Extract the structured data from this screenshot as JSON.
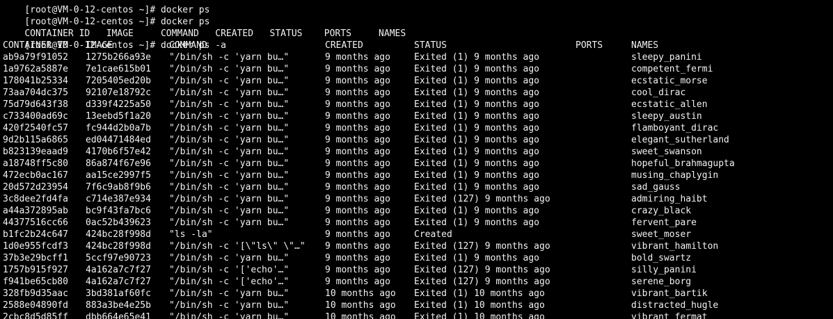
{
  "terminal": {
    "first_line_partial": "[root@VM-0-12-centos ~]# docker ps",
    "cmd1_prompt": "[root@VM-0-12-centos ~]# docker ps",
    "cmd1_header": "CONTAINER ID   IMAGE     COMMAND   CREATED   STATUS    PORTS     NAMES",
    "cmd2_prompt": "[root@VM-0-12-centos ~]# docker ps -a",
    "columns": [
      "CONTAINER ID",
      "IMAGE",
      "COMMAND",
      "CREATED",
      "STATUS",
      "PORTS",
      "NAMES"
    ],
    "rows": [
      {
        "id": "ab9a79f91052",
        "image": "1275b266a93e",
        "command": "\"/bin/sh -c 'yarn bu…\"",
        "created": "9 months ago",
        "status": "Exited (1) 9 months ago",
        "ports": "",
        "name": "sleepy_panini"
      },
      {
        "id": "1a9762a5887e",
        "image": "7e1cae615b01",
        "command": "\"/bin/sh -c 'yarn bu…\"",
        "created": "9 months ago",
        "status": "Exited (1) 9 months ago",
        "ports": "",
        "name": "competent_fermi"
      },
      {
        "id": "178041b25334",
        "image": "7205405ed20b",
        "command": "\"/bin/sh -c 'yarn bu…\"",
        "created": "9 months ago",
        "status": "Exited (1) 9 months ago",
        "ports": "",
        "name": "ecstatic_morse"
      },
      {
        "id": "73aa704dc375",
        "image": "92107e18792c",
        "command": "\"/bin/sh -c 'yarn bu…\"",
        "created": "9 months ago",
        "status": "Exited (1) 9 months ago",
        "ports": "",
        "name": "cool_dirac"
      },
      {
        "id": "75d79d643f38",
        "image": "d339f4225a50",
        "command": "\"/bin/sh -c 'yarn bu…\"",
        "created": "9 months ago",
        "status": "Exited (1) 9 months ago",
        "ports": "",
        "name": "ecstatic_allen"
      },
      {
        "id": "c733400ad69c",
        "image": "13eebd5f1a20",
        "command": "\"/bin/sh -c 'yarn bu…\"",
        "created": "9 months ago",
        "status": "Exited (1) 9 months ago",
        "ports": "",
        "name": "sleepy_austin"
      },
      {
        "id": "420f2540fc57",
        "image": "fc944d2b0a7b",
        "command": "\"/bin/sh -c 'yarn bu…\"",
        "created": "9 months ago",
        "status": "Exited (1) 9 months ago",
        "ports": "",
        "name": "flamboyant_dirac"
      },
      {
        "id": "9d2b115a6865",
        "image": "ed04471484ed",
        "command": "\"/bin/sh -c 'yarn bu…\"",
        "created": "9 months ago",
        "status": "Exited (1) 9 months ago",
        "ports": "",
        "name": "elegant_sutherland"
      },
      {
        "id": "b823139eaad9",
        "image": "4170b6f57e42",
        "command": "\"/bin/sh -c 'yarn bu…\"",
        "created": "9 months ago",
        "status": "Exited (1) 9 months ago",
        "ports": "",
        "name": "sweet_swanson"
      },
      {
        "id": "a18748ff5c80",
        "image": "86a874f67e96",
        "command": "\"/bin/sh -c 'yarn bu…\"",
        "created": "9 months ago",
        "status": "Exited (1) 9 months ago",
        "ports": "",
        "name": "hopeful_brahmagupta"
      },
      {
        "id": "472ecb0ac167",
        "image": "aa15ce2997f5",
        "command": "\"/bin/sh -c 'yarn bu…\"",
        "created": "9 months ago",
        "status": "Exited (1) 9 months ago",
        "ports": "",
        "name": "musing_chaplygin"
      },
      {
        "id": "20d572d23954",
        "image": "7f6c9ab8f9b6",
        "command": "\"/bin/sh -c 'yarn bu…\"",
        "created": "9 months ago",
        "status": "Exited (1) 9 months ago",
        "ports": "",
        "name": "sad_gauss"
      },
      {
        "id": "3c8dee2fd4fa",
        "image": "c714e387e934",
        "command": "\"/bin/sh -c 'yarn bu…\"",
        "created": "9 months ago",
        "status": "Exited (127) 9 months ago",
        "ports": "",
        "name": "admiring_haibt"
      },
      {
        "id": "a44a372895ab",
        "image": "bc9f43fa7bc6",
        "command": "\"/bin/sh -c 'yarn bu…\"",
        "created": "9 months ago",
        "status": "Exited (1) 9 months ago",
        "ports": "",
        "name": "crazy_black"
      },
      {
        "id": "44377516cc66",
        "image": "0ac52b439623",
        "command": "\"/bin/sh -c 'yarn bu…\"",
        "created": "9 months ago",
        "status": "Exited (1) 9 months ago",
        "ports": "",
        "name": "fervent_pare"
      },
      {
        "id": "b1fc2b24c647",
        "image": "424bc28f998d",
        "command": "\"ls -la\"",
        "created": "9 months ago",
        "status": "Created",
        "ports": "",
        "name": "sweet_moser"
      },
      {
        "id": "1d0e955fcdf3",
        "image": "424bc28f998d",
        "command": "\"/bin/sh -c '[\\\"ls\\\" \\\"…\"",
        "created": "9 months ago",
        "status": "Exited (127) 9 months ago",
        "ports": "",
        "name": "vibrant_hamilton"
      },
      {
        "id": "37b3e29bcff1",
        "image": "5ccf97e90723",
        "command": "\"/bin/sh -c 'yarn bu…\"",
        "created": "9 months ago",
        "status": "Exited (1) 9 months ago",
        "ports": "",
        "name": "bold_swartz"
      },
      {
        "id": "1757b915f927",
        "image": "4a162a7c7f27",
        "command": "\"/bin/sh -c '['echo'…\"",
        "created": "9 months ago",
        "status": "Exited (127) 9 months ago",
        "ports": "",
        "name": "silly_panini"
      },
      {
        "id": "f941be65cb80",
        "image": "4a162a7c7f27",
        "command": "\"/bin/sh -c '['echo'…\"",
        "created": "9 months ago",
        "status": "Exited (127) 9 months ago",
        "ports": "",
        "name": "serene_borg"
      },
      {
        "id": "328fb9d35aac",
        "image": "3bd381af60fc",
        "command": "\"/bin/sh -c 'yarn bu…\"",
        "created": "10 months ago",
        "status": "Exited (1) 10 months ago",
        "ports": "",
        "name": "vibrant_bartik"
      },
      {
        "id": "2588e04890fd",
        "image": "883a3be4e25b",
        "command": "\"/bin/sh -c 'yarn bu…\"",
        "created": "10 months ago",
        "status": "Exited (1) 10 months ago",
        "ports": "",
        "name": "distracted_hugle"
      },
      {
        "id": "2cbc8d5d85ff",
        "image": "dbb664e65e41",
        "command": "\"/bin/sh -c 'yarn bu…\"",
        "created": "10 months ago",
        "status": "Exited (1) 10 months ago",
        "ports": "",
        "name": "vibrant_fermat"
      }
    ]
  },
  "colors": {
    "background": "#000000",
    "text": "#f2f2f2"
  }
}
